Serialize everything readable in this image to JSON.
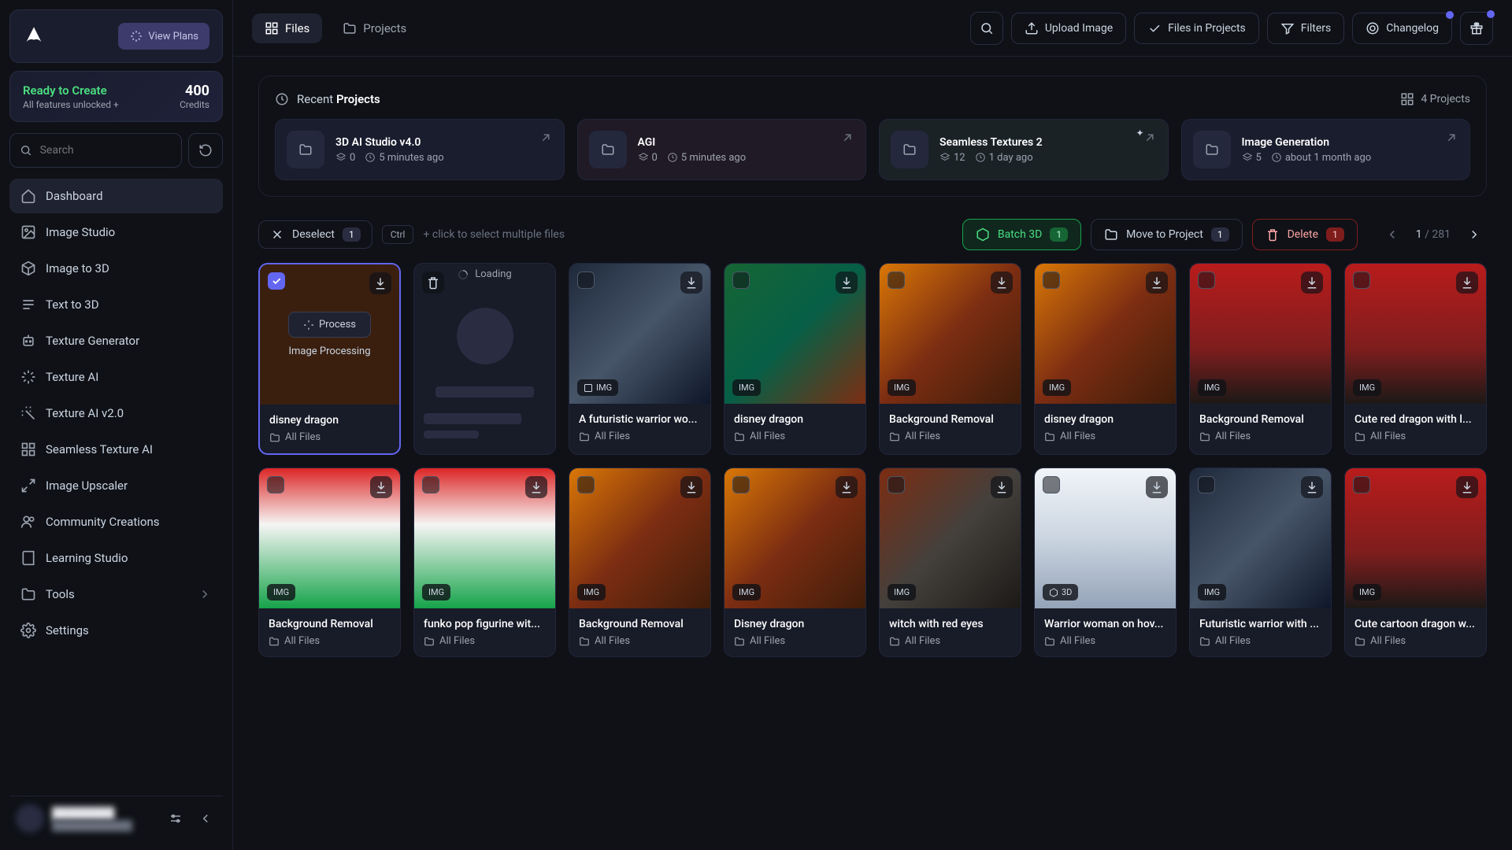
{
  "sidebar": {
    "view_plans": "View Plans",
    "status_title": "Ready to Create",
    "status_sub": "All features unlocked +",
    "credits_num": "400",
    "credits_label": "Credits",
    "search_placeholder": "Search",
    "nav": [
      "Dashboard",
      "Image Studio",
      "Image to 3D",
      "Text to 3D",
      "Texture Generator",
      "Texture AI",
      "Texture AI v2.0",
      "Seamless Texture AI",
      "Image Upscaler",
      "Community Creations",
      "Learning Studio",
      "Tools",
      "Settings"
    ]
  },
  "topbar": {
    "tabs": {
      "files": "Files",
      "projects": "Projects"
    },
    "upload": "Upload Image",
    "files_in_projects": "Files in Projects",
    "filters": "Filters",
    "changelog": "Changelog"
  },
  "recent": {
    "prefix": "Recent",
    "suffix": "Projects",
    "count_label": "4 Projects",
    "items": [
      {
        "name": "3D AI Studio v4.0",
        "count": "0",
        "time": "5 minutes ago"
      },
      {
        "name": "AGI",
        "count": "0",
        "time": "5 minutes ago"
      },
      {
        "name": "Seamless Textures 2",
        "count": "12",
        "time": "1 day ago"
      },
      {
        "name": "Image Generation",
        "count": "5",
        "time": "about 1 month ago"
      }
    ]
  },
  "actions": {
    "deselect": "Deselect",
    "selection_count": "1",
    "kbd": "Ctrl",
    "hint": "+ click to select multiple files",
    "batch": "Batch 3D",
    "batch_count": "1",
    "move": "Move to Project",
    "move_count": "1",
    "delete": "Delete",
    "delete_count": "1",
    "page_current": "1",
    "page_total": "281"
  },
  "process": {
    "btn": "Process",
    "label": "Image Processing",
    "loading": "Loading"
  },
  "badges": {
    "img": "IMG",
    "three_d": "3D"
  },
  "all_files": "All Files",
  "files": [
    {
      "title": "disney dragon"
    },
    {
      "title": ""
    },
    {
      "title": "A futuristic warrior wo..."
    },
    {
      "title": "disney dragon"
    },
    {
      "title": "Background Removal"
    },
    {
      "title": "disney dragon"
    },
    {
      "title": "Background Removal"
    },
    {
      "title": "Cute red dragon with l..."
    },
    {
      "title": "Background Removal"
    },
    {
      "title": "funko pop figurine wit..."
    },
    {
      "title": "Background Removal"
    },
    {
      "title": "Disney dragon"
    },
    {
      "title": "witch with red eyes"
    },
    {
      "title": "Warrior woman on hov..."
    },
    {
      "title": "Futuristic warrior with ..."
    },
    {
      "title": "Cute cartoon dragon w..."
    }
  ]
}
